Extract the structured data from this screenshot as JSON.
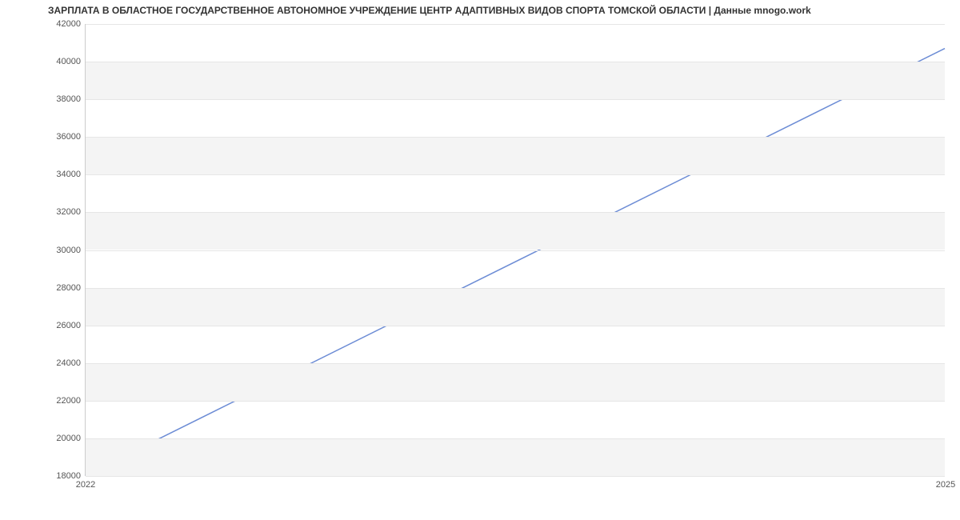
{
  "chart_data": {
    "type": "line",
    "title": "ЗАРПЛАТА В ОБЛАСТНОЕ ГОСУДАРСТВЕННОЕ АВТОНОМНОЕ УЧРЕЖДЕНИЕ ЦЕНТР АДАПТИВНЫХ ВИДОВ СПОРТА ТОМСКОЙ ОБЛАСТИ | Данные mnogo.work",
    "x": [
      2022,
      2025
    ],
    "series": [
      {
        "name": "Зарплата",
        "values": [
          18000,
          40700
        ],
        "color": "#6c8cd5"
      }
    ],
    "xlabel": "",
    "ylabel": "",
    "xlim": [
      2022,
      2025
    ],
    "ylim": [
      18000,
      42000
    ],
    "x_ticks": [
      2022,
      2025
    ],
    "y_ticks": [
      18000,
      20000,
      22000,
      24000,
      26000,
      28000,
      30000,
      32000,
      34000,
      36000,
      38000,
      40000,
      42000
    ],
    "grid": true,
    "bands": true
  }
}
